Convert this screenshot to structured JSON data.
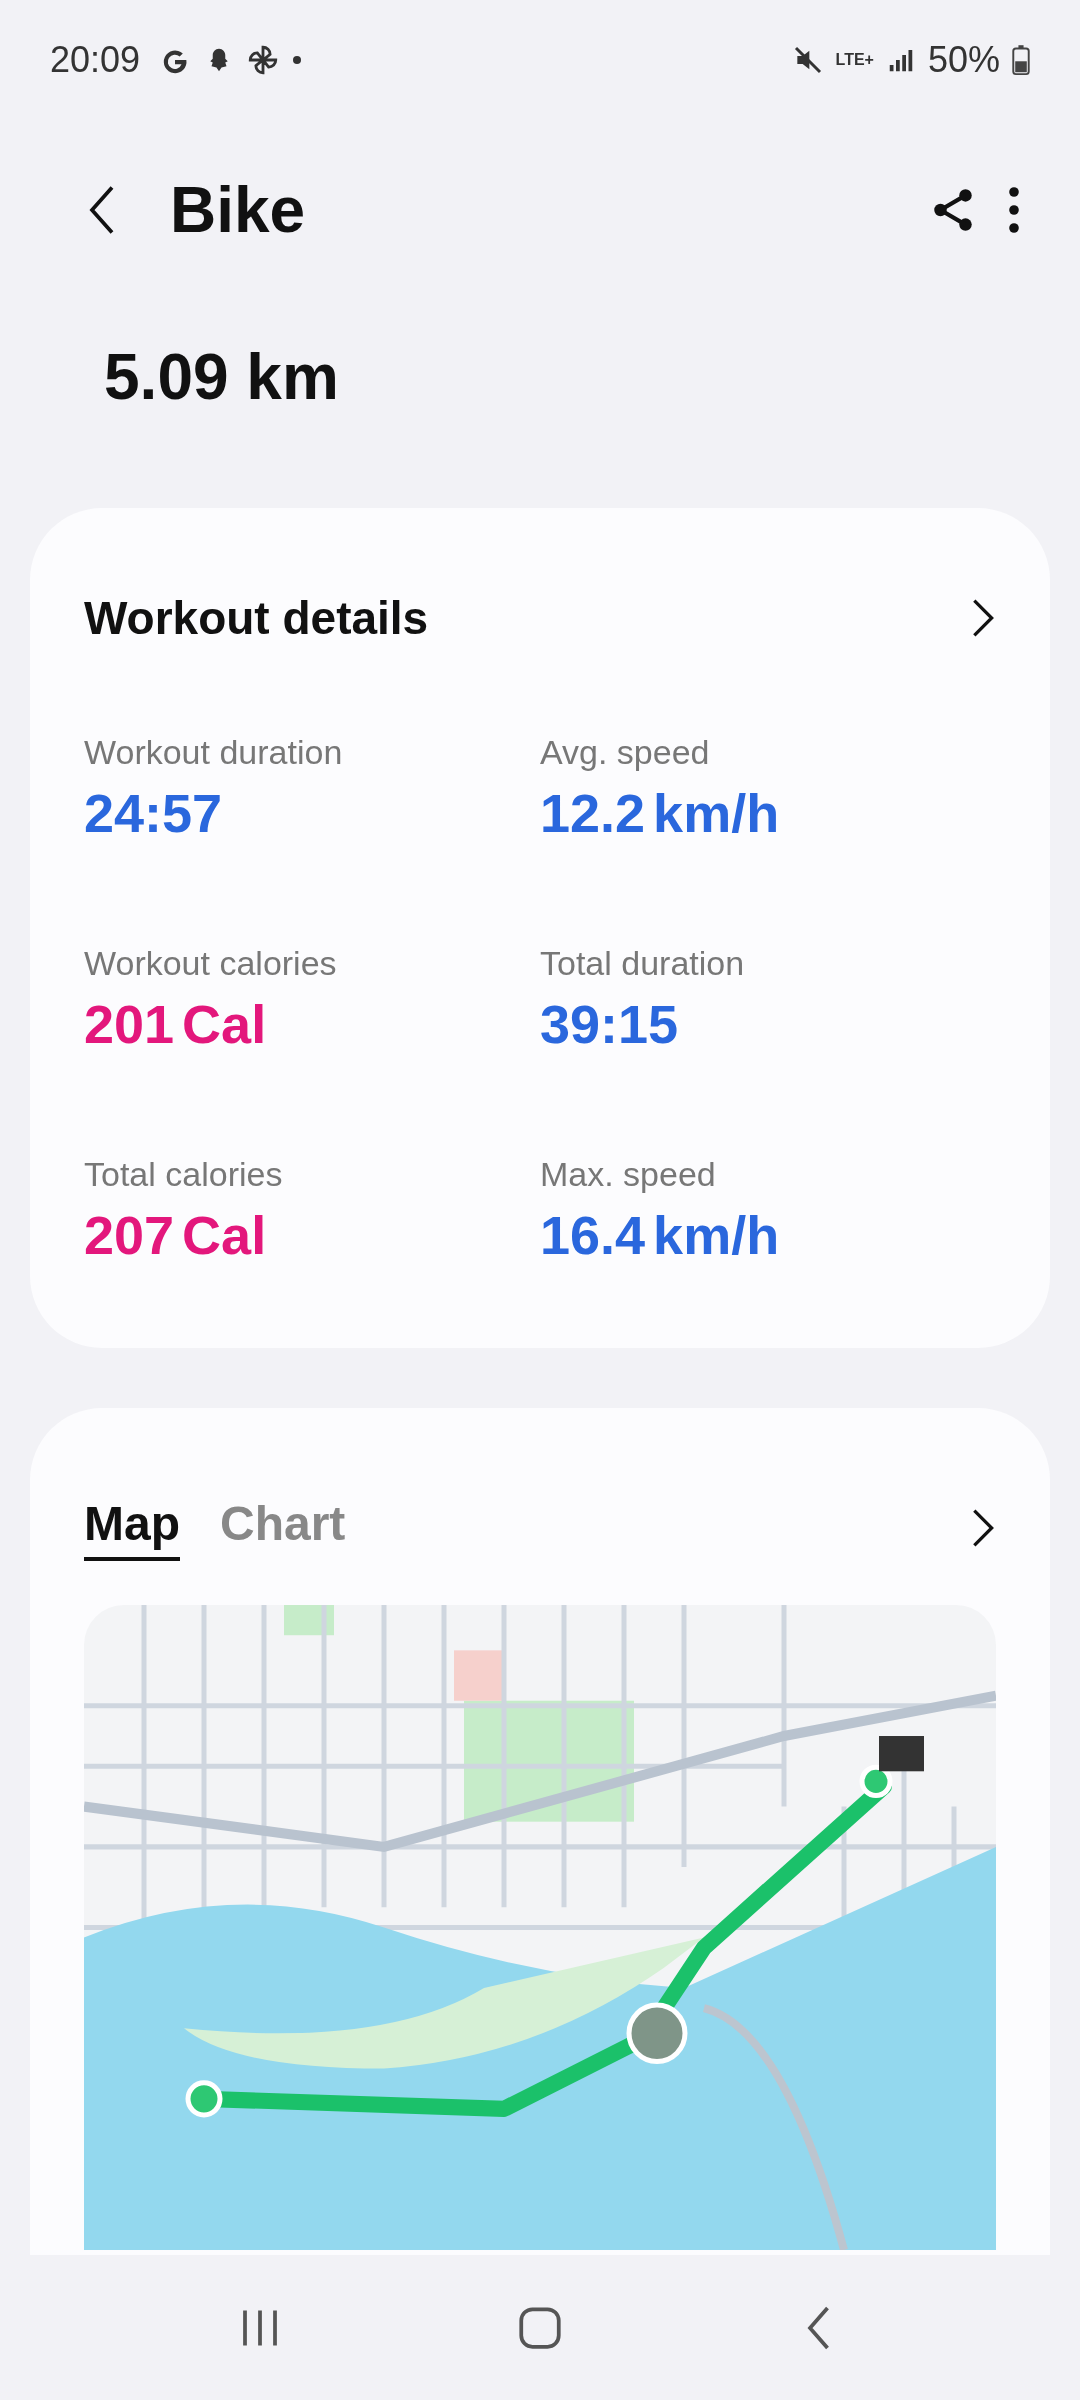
{
  "status_bar": {
    "time": "20:09",
    "network": "LTE+",
    "battery": "50%"
  },
  "header": {
    "title": "Bike"
  },
  "distance": "5.09 km",
  "workout_details": {
    "title": "Workout details",
    "stats": [
      {
        "label": "Workout duration",
        "value": "24:57",
        "kind": "time"
      },
      {
        "label": "Avg. speed",
        "value": "12.2",
        "unit": "km/h",
        "kind": "speed"
      },
      {
        "label": "Workout calories",
        "value": "201",
        "unit": "Cal",
        "kind": "calories"
      },
      {
        "label": "Total duration",
        "value": "39:15",
        "kind": "time"
      },
      {
        "label": "Total calories",
        "value": "207",
        "unit": "Cal",
        "kind": "calories"
      },
      {
        "label": "Max. speed",
        "value": "16.4",
        "unit": "km/h",
        "kind": "speed"
      }
    ]
  },
  "route": {
    "tabs": [
      {
        "label": "Map",
        "selected": true
      },
      {
        "label": "Chart",
        "selected": false
      }
    ]
  }
}
